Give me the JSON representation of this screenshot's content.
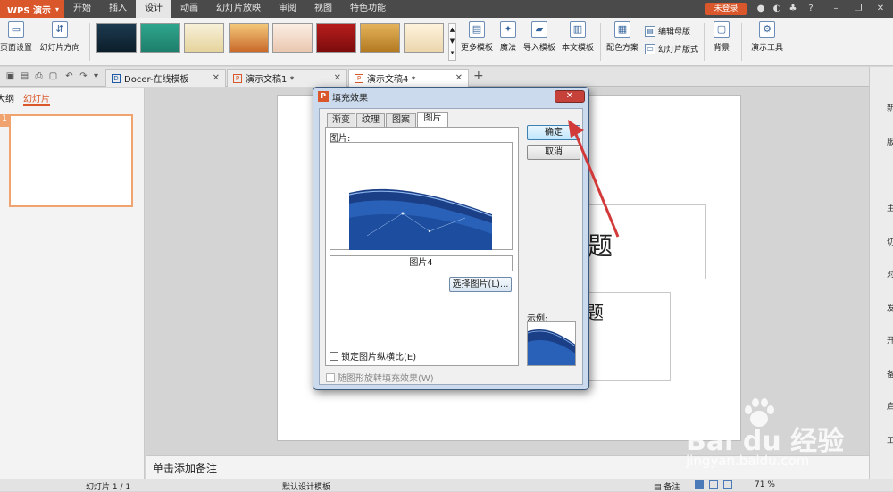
{
  "app": {
    "name": "WPS 演示"
  },
  "menu": {
    "items": [
      "开始",
      "插入",
      "设计",
      "动画",
      "幻灯片放映",
      "审阅",
      "视图",
      "特色功能"
    ],
    "active_index": 2,
    "login": "未登录"
  },
  "ribbon": {
    "page_setup": "页面设置",
    "slide_direction": "幻灯片方向",
    "more_templates": "更多模板",
    "magic": "魔法",
    "import_template": "导入模板",
    "text_template": "本文模板",
    "color_scheme": "配色方案",
    "edit_master": "编辑母版",
    "slide_layout": "幻灯片版式",
    "background": "背景",
    "presentation_tools": "演示工具"
  },
  "tabs": [
    {
      "label": "Docer-在线模板"
    },
    {
      "label": "演示文稿1 *"
    },
    {
      "label": "演示文稿4 *"
    }
  ],
  "left_panel": {
    "tab_outline": "大纲",
    "tab_slides": "幻灯片",
    "slide_number": "1"
  },
  "slide": {
    "title_fragment": "题",
    "subtitle_fragment": "题"
  },
  "notes": {
    "placeholder": "单击添加备注"
  },
  "status": {
    "slide_counter": "幻灯片 1 / 1",
    "design_template": "默认设计模板",
    "notes": "备注",
    "zoom": "71 %"
  },
  "dialog": {
    "title": "填充效果",
    "tabs": [
      "渐变",
      "纹理",
      "图案",
      "图片"
    ],
    "active_tab_index": 3,
    "picture_label": "图片:",
    "picture_name": "图片4",
    "select_button": "选择图片(L)...",
    "lock_ratio": "锁定图片纵横比(E)",
    "rotate_with_shape": "随图形旋转填充效果(W)",
    "ok": "确定",
    "cancel": "取消",
    "example_label": "示例:"
  },
  "right_strip": {
    "labels": [
      "新",
      "版",
      "主",
      "切",
      "对",
      "发",
      "开",
      "备",
      "启",
      "工"
    ]
  },
  "watermark": {
    "brand": "Bai du 经验",
    "url": "jingyan.baidu.com"
  },
  "colors": {
    "brand_orange": "#d9572a",
    "arrow_red": "#d23a3a",
    "accent_blue": "#1f5aa6"
  }
}
